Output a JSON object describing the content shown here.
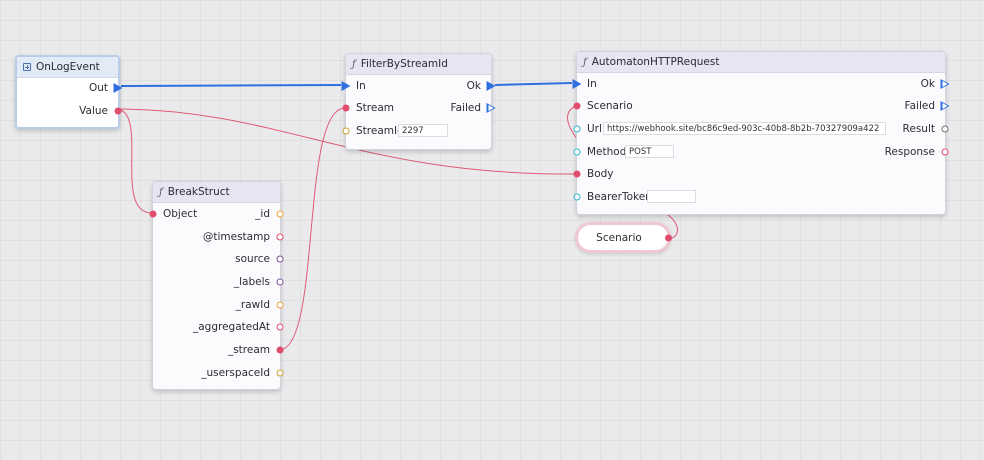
{
  "nodes": {
    "onlogevent": {
      "title": "OnLogEvent",
      "out_label": "Out",
      "value_label": "Value"
    },
    "filterbystreamid": {
      "title": "FilterByStreamId",
      "in_label": "In",
      "ok_label": "Ok",
      "stream_label": "Stream",
      "failed_label": "Failed",
      "streamid_label": "StreamId",
      "streamid_value": "2297"
    },
    "automatonhttprequest": {
      "title": "AutomatonHTTPRequest",
      "in_label": "In",
      "ok_label": "Ok",
      "scenario_label": "Scenario",
      "failed_label": "Failed",
      "url_label": "Url",
      "url_value": "https://webhook.site/bc86c9ed-903c-40b8-8b2b-70327909a422",
      "result_label": "Result",
      "method_label": "Method",
      "method_value": "POST",
      "response_label": "Response",
      "body_label": "Body",
      "bearertoken_label": "BearerToken",
      "bearertoken_value": ""
    },
    "breakstruct": {
      "title": "BreakStruct",
      "object_label": "Object",
      "outputs": [
        "_id",
        "@timestamp",
        "source",
        "_labels",
        "_rawId",
        "_aggregatedAt",
        "_stream",
        "_userspaceId"
      ]
    }
  },
  "reroute": {
    "label": "Scenario"
  },
  "colors": {
    "exec": "#2f6fe0",
    "struct_pin": "#df4d6c",
    "string_pin": "#30b4d0",
    "number_pin": "#c9a328",
    "id_pin": "#f0a040",
    "array_pin": "#7b55a0",
    "generic_pin": "#707070"
  }
}
